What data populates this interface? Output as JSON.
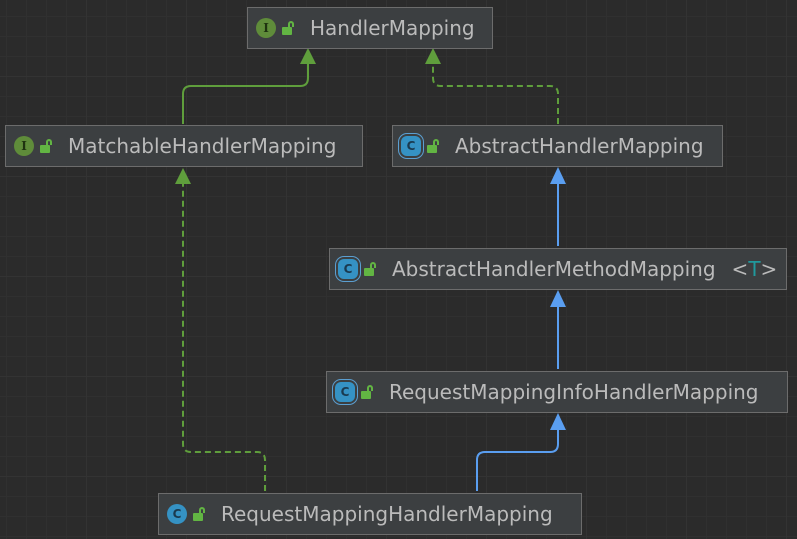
{
  "nodes": {
    "handler_mapping": {
      "label": "HandlerMapping",
      "kind": "interface",
      "badge": "I"
    },
    "matchable_handler_mapping": {
      "label": "MatchableHandlerMapping",
      "kind": "interface",
      "badge": "I"
    },
    "abstract_handler_mapping": {
      "label": "AbstractHandlerMapping",
      "kind": "abstract",
      "badge": "C"
    },
    "abstract_handler_method_mapping": {
      "label": "AbstractHandlerMethodMapping",
      "kind": "abstract",
      "badge": "C",
      "generic_open": "<",
      "generic_param": "T",
      "generic_close": ">"
    },
    "request_mapping_info_handler_mapping": {
      "label": "RequestMappingInfoHandlerMapping",
      "kind": "abstract",
      "badge": "C"
    },
    "request_mapping_handler_mapping": {
      "label": "RequestMappingHandlerMapping",
      "kind": "class",
      "badge": "C"
    }
  },
  "edges": [
    {
      "from": "MatchableHandlerMapping",
      "to": "HandlerMapping",
      "type": "extends",
      "style": "solid",
      "color": "#5f9e3c"
    },
    {
      "from": "AbstractHandlerMapping",
      "to": "HandlerMapping",
      "type": "implements",
      "style": "dashed",
      "color": "#5f9e3c"
    },
    {
      "from": "AbstractHandlerMethodMapping",
      "to": "AbstractHandlerMapping",
      "type": "extends",
      "style": "solid",
      "color": "#5a9ef0"
    },
    {
      "from": "RequestMappingInfoHandlerMapping",
      "to": "AbstractHandlerMethodMapping",
      "type": "extends",
      "style": "solid",
      "color": "#5a9ef0"
    },
    {
      "from": "RequestMappingHandlerMapping",
      "to": "RequestMappingInfoHandlerMapping",
      "type": "extends",
      "style": "solid",
      "color": "#5a9ef0"
    },
    {
      "from": "RequestMappingHandlerMapping",
      "to": "MatchableHandlerMapping",
      "type": "implements",
      "style": "dashed",
      "color": "#5f9e3c"
    }
  ],
  "colors": {
    "background": "#2b2b2b",
    "node_fill": "#3c3f41",
    "node_border": "#6c6c6c",
    "text": "#bbbbbb",
    "interface_badge": "#5f8c3a",
    "class_badge": "#3592c4",
    "lock": "#62b543",
    "type_param": "#20999d"
  },
  "icons": {
    "interface": "interface-icon",
    "class": "class-icon",
    "abstract": "abstract-class-icon",
    "visibility": "public-lock-icon"
  }
}
